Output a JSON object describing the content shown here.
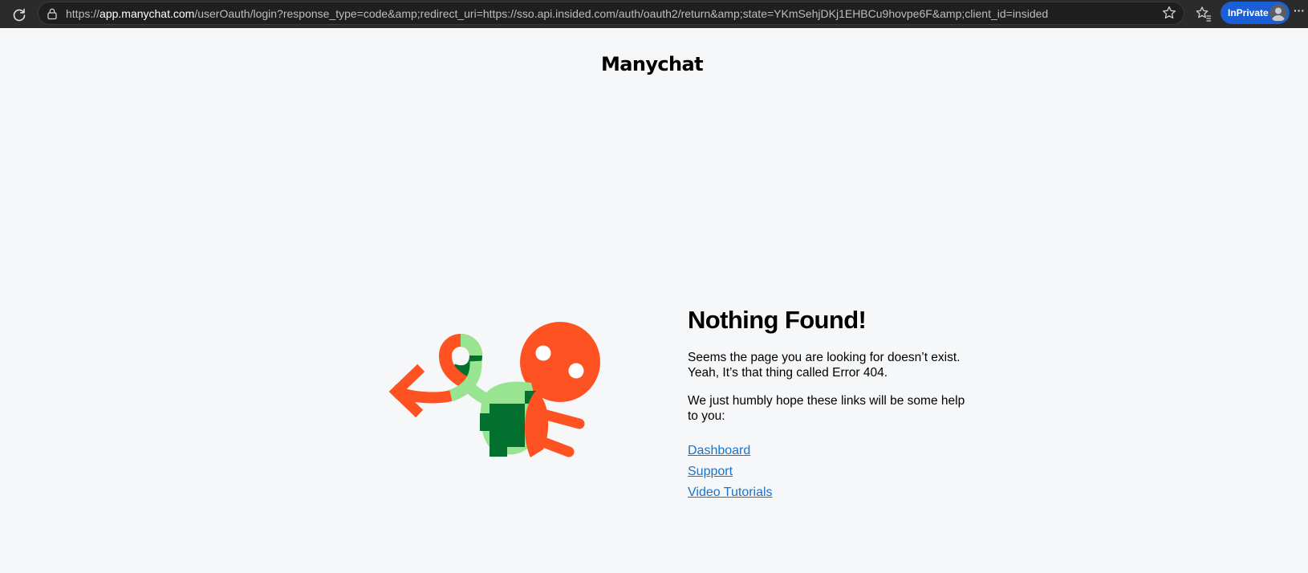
{
  "browser": {
    "url_scheme": "https://",
    "url_host": "app.manychat.com",
    "url_path": "/userOauth/login?response_type=code&amp;redirect_uri=https://sso.api.insided.com/auth/oauth2/return&amp;state=YKmSehjDKj1EHBCu9hovpe6F&amp;client_id=insided",
    "inprivate_label": "InPrivate",
    "icons": [
      "reload-icon",
      "lock-icon",
      "star-icon",
      "favorites-icon",
      "avatar-icon",
      "more-icon"
    ]
  },
  "page": {
    "logo_text": "Manychat",
    "heading": "Nothing Found!",
    "paragraph1_line1": "Seems the page you are looking for doesn’t exist.",
    "paragraph1_line2": "Yeah, It’s that thing called Error 404.",
    "paragraph2_line1": "We just humbly hope these links will be some help",
    "paragraph2_line2": "to you:",
    "links": [
      {
        "label": "Dashboard"
      },
      {
        "label": "Support"
      },
      {
        "label": "Video Tutorials"
      }
    ]
  },
  "colors": {
    "accent_orange": "#ff5222",
    "light_green": "#98e491",
    "dark_green": "#04702f",
    "link_blue": "#1a73c8",
    "page_bg": "#f6f7f9",
    "inprivate_blue": "#1b5fd6"
  }
}
